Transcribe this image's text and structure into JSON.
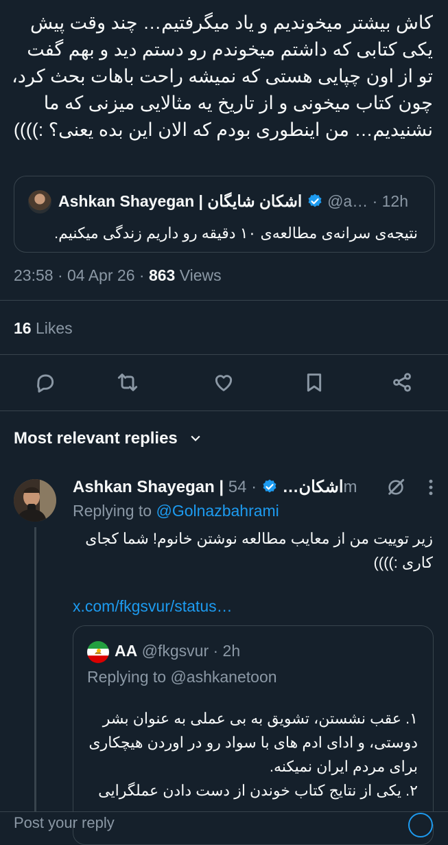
{
  "tweet": {
    "body_lines": [
      "کاش بیشتر میخوندیم و یاد میگرفتیم… چند وقت پیش",
      "یکی کتابی که داشتم میخوندم رو دستم دید و بهم گفت",
      "تو از اون چپایی هستی که نمیشه راحت باهات بحث کرد،",
      "چون کتاب میخونی و از تاریخ یه مثالایی میزنی که ما",
      "نشنیدیم… من اینطوری بودم که الان این بده یعنی؟ :))))"
    ],
    "quoted": {
      "name": "Ashkan Shayegan | اشکان شایگان",
      "handle": "@a…",
      "time": "· 12h",
      "text": "نتیجه‌ی سرانه‌ی مطالعه‌ی ۱۰ دقیقه رو داریم زندگی میکنیم."
    },
    "meta": {
      "time": "23:58",
      "date": "04 Apr 26",
      "views_count": "863",
      "views_label": "Views"
    },
    "likes": {
      "count": "16",
      "label": "Likes"
    },
    "actions": [
      "reply-icon",
      "retweet-icon",
      "like-icon",
      "bookmark-icon",
      "share-icon"
    ]
  },
  "replies_section": {
    "title": "Most relevant replies"
  },
  "reply": {
    "name": "Ashkan Shayegan | اشکان…",
    "time": "· 54m",
    "replying_prefix": "Replying to",
    "replying_handle": "@Golnazbahrami",
    "text": "زیر توییت من از معایب مطالعه نوشتن خانوم! شما کجای کاری :))))",
    "link": "x.com/fkgsvur/status…",
    "quoted": {
      "name": "AA",
      "handle": "@fkgsvur",
      "time": "· 2h",
      "replying": "Replying to @ashkanetoon",
      "lines": [
        "۱. عقب نشستن، تشویق به بی عملی به عنوان بشر",
        "دوستی، و ادای ادم های با سواد رو در اوردن هیچکاری",
        "برای مردم ایران نمیکنه.",
        "۲. یکی از نتایج کتاب خوندن از دست دادن عملگرایی"
      ]
    }
  },
  "compose": {
    "placeholder": "Post your reply"
  },
  "colors": {
    "background": "#15202b",
    "accent": "#1d9bf0",
    "muted": "#8b98a5",
    "border": "#38444d"
  }
}
